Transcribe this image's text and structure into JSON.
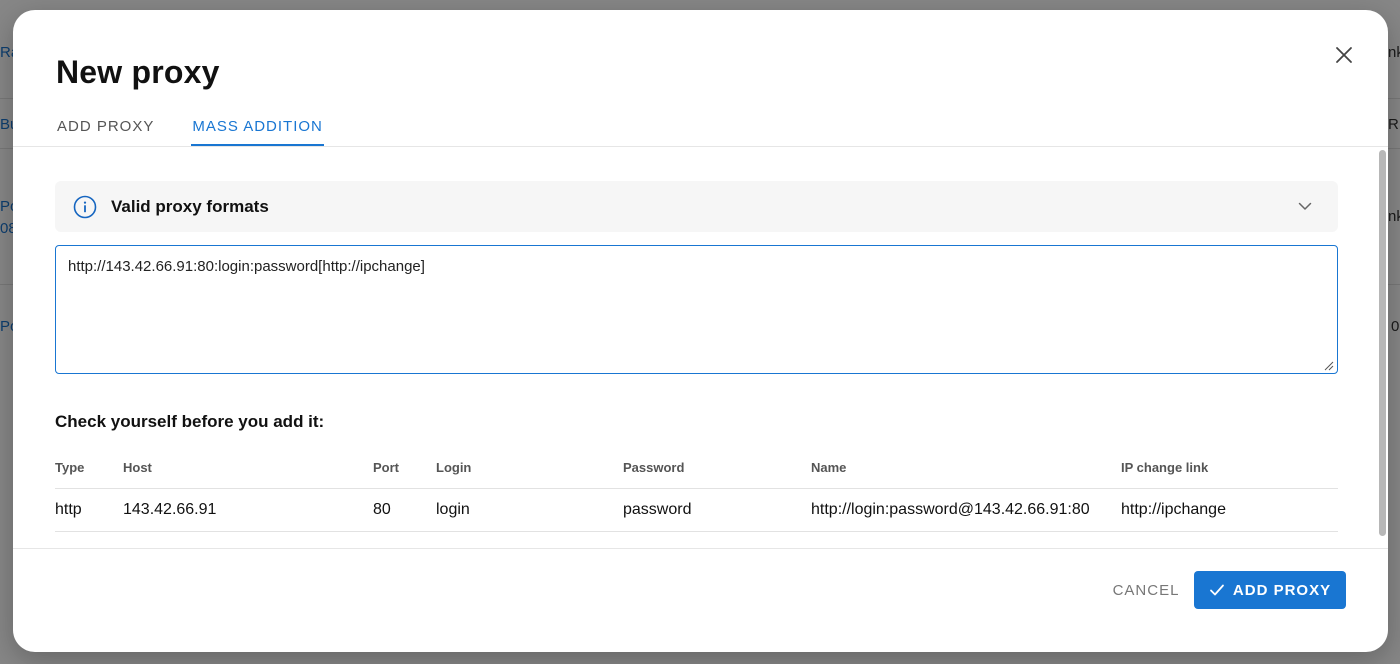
{
  "background": {
    "fragments": [
      "Ra",
      "nk",
      "Bu",
      "RI",
      "Po",
      "08",
      "nk",
      "Po",
      "0"
    ]
  },
  "dialog": {
    "title": "New proxy",
    "close_icon": "close-icon",
    "tabs": [
      {
        "label": "ADD PROXY",
        "active": false
      },
      {
        "label": "MASS ADDITION",
        "active": true
      }
    ],
    "info_panel": {
      "icon": "info-icon",
      "title": "Valid proxy formats",
      "expand_icon": "chevron-down-icon"
    },
    "proxy_input": {
      "value": "http://143.42.66.91:80:login:password[http://ipchange]"
    },
    "check_title": "Check yourself before you add it:",
    "table": {
      "columns": [
        "Type",
        "Host",
        "Port",
        "Login",
        "Password",
        "Name",
        "IP change link"
      ],
      "rows": [
        [
          "http",
          "143.42.66.91",
          "80",
          "login",
          "password",
          "http://login:password@143.42.66.91:80",
          "http://ipchange"
        ]
      ]
    },
    "footer": {
      "cancel_label": "CANCEL",
      "add_label": "ADD PROXY",
      "add_icon": "check-icon"
    }
  },
  "colors": {
    "accent": "#1976d2",
    "overlay": "rgba(0,0,0,0.47)"
  }
}
